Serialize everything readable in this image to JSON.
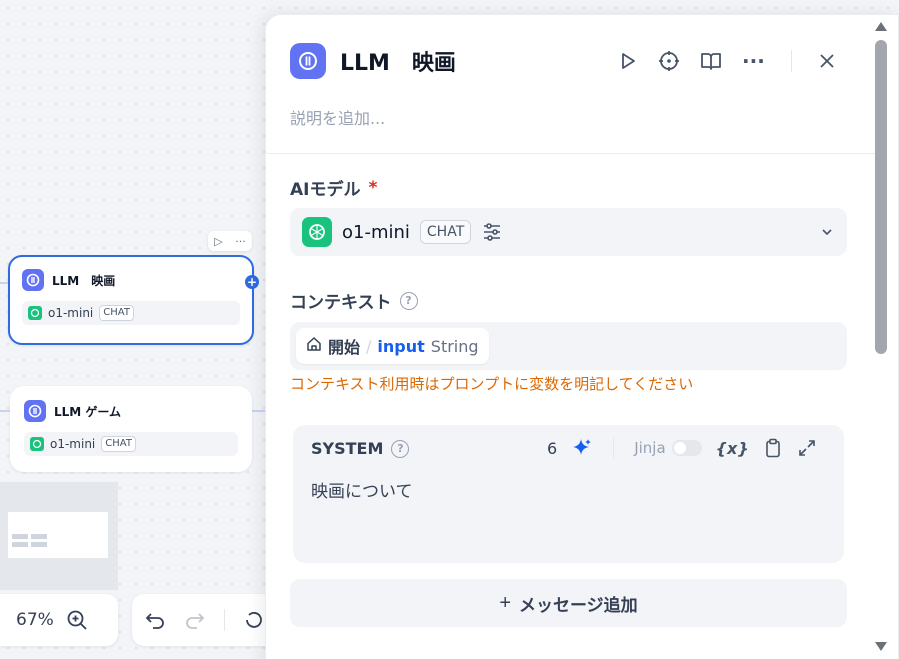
{
  "canvas": {
    "nodes": [
      {
        "title": "LLM　映画",
        "model": "o1-mini",
        "badge": "CHAT"
      },
      {
        "title": "LLM ゲーム",
        "model": "o1-mini",
        "badge": "CHAT"
      }
    ],
    "zoom": "67%"
  },
  "panel": {
    "title": "LLM　映画",
    "description_placeholder": "説明を追加...",
    "model_section": {
      "label": "AIモデル",
      "required_mark": "*",
      "model": "o1-mini",
      "badge": "CHAT"
    },
    "context_section": {
      "label": "コンテキスト",
      "variable": {
        "node": "開始",
        "separator": "/",
        "name": "input",
        "type": "String"
      },
      "warning": "コンテキスト利用時はプロンプトに変数を明記してください"
    },
    "system": {
      "label": "SYSTEM",
      "token_count": "6",
      "jinja_label": "Jinja",
      "jinja_enabled": false,
      "var_button": "{x}",
      "text": "映画について"
    },
    "add_message_label": "メッセージ追加"
  },
  "colors": {
    "accent": "#155eef",
    "selected_border": "#2e6ce0",
    "warning": "#dc6803",
    "llm_icon": "#6172f3",
    "gpt_icon": "#19c37d"
  }
}
